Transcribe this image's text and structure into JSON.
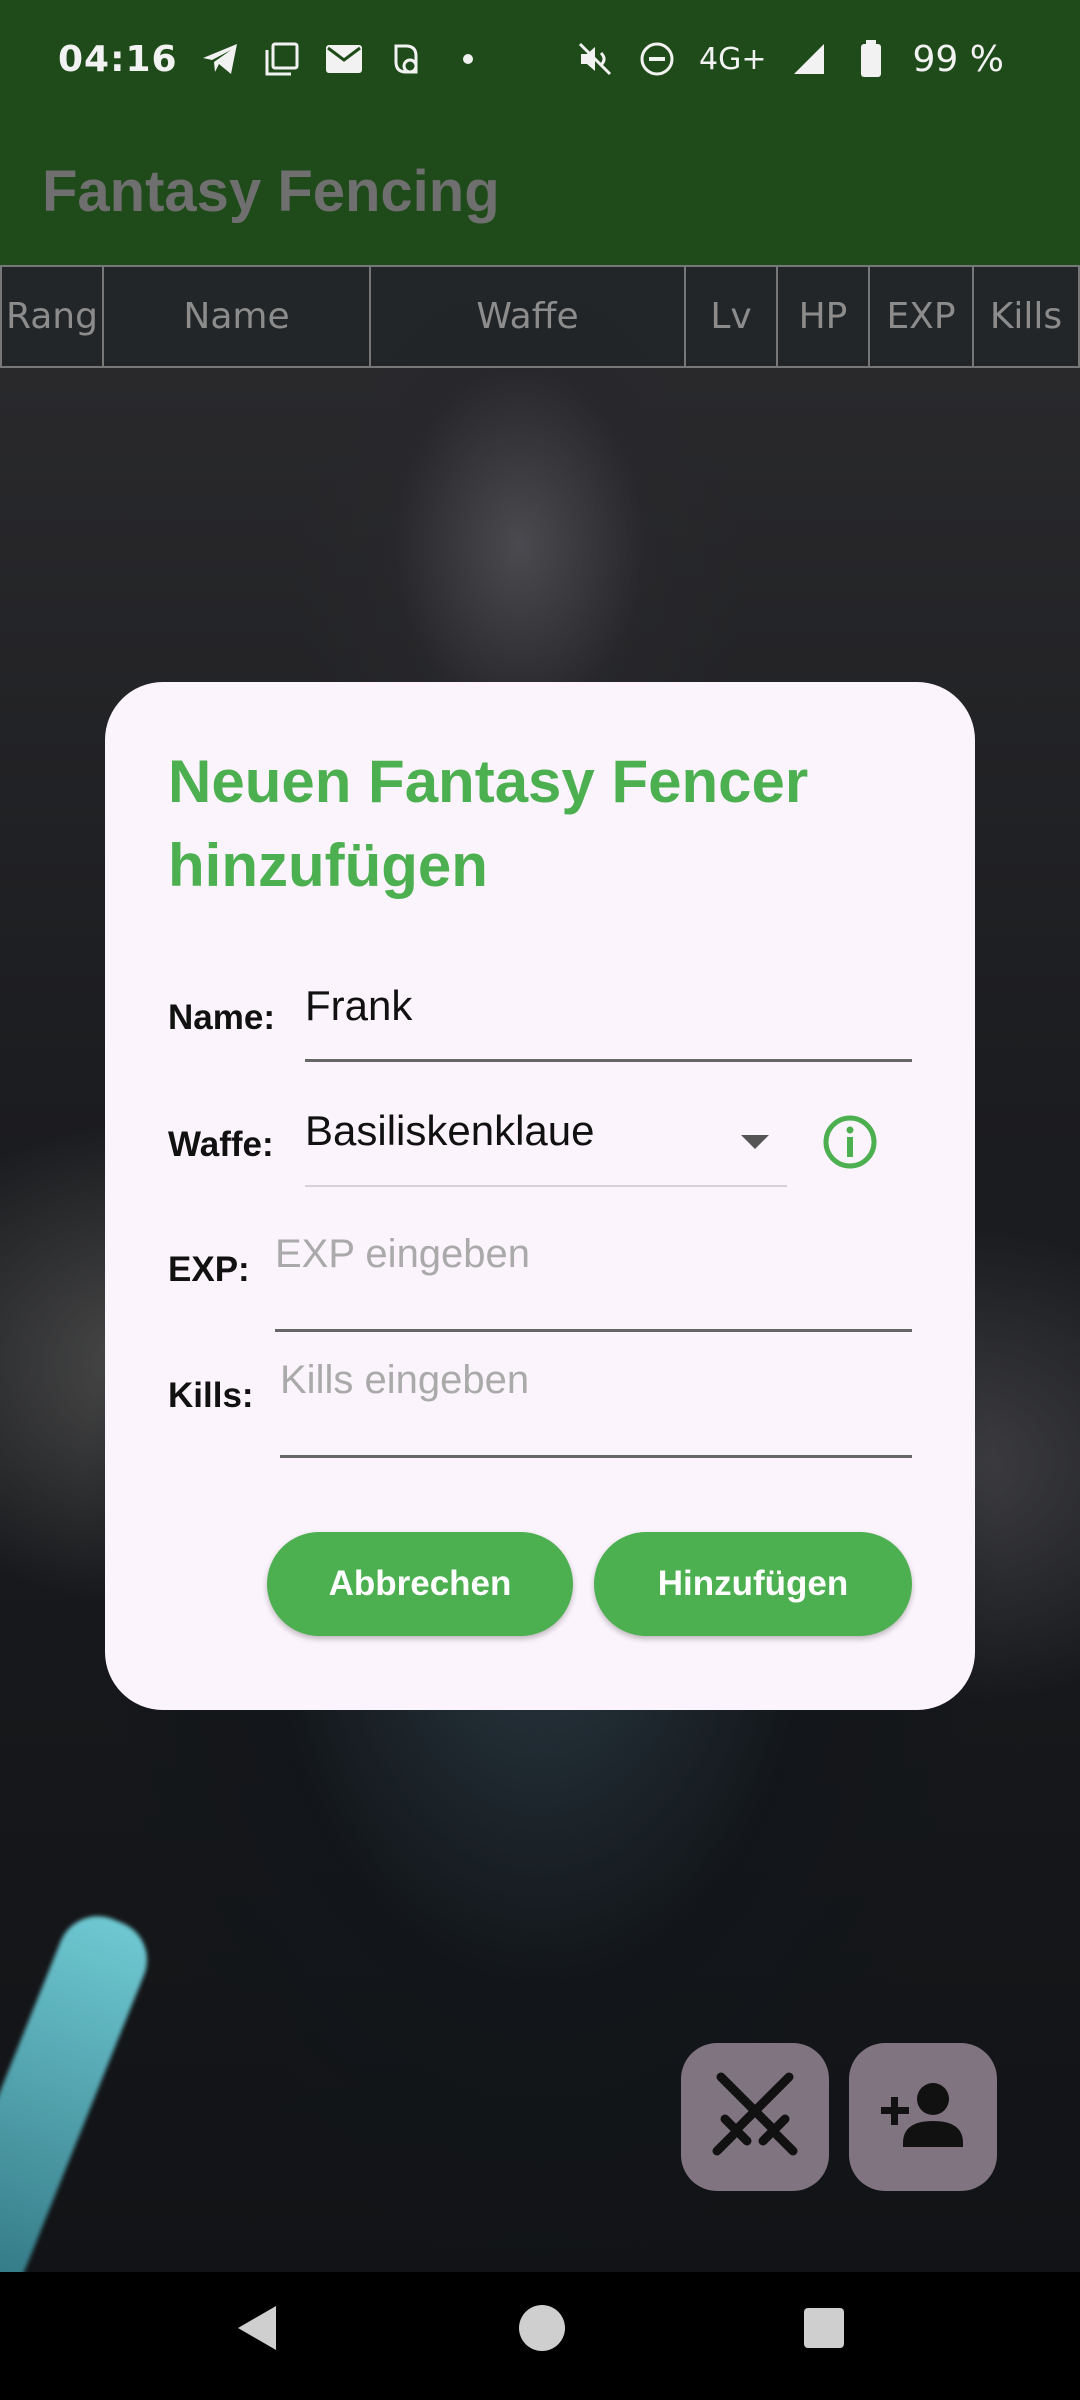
{
  "status_bar": {
    "time": "04:16",
    "left_icons": [
      "telegram-icon",
      "screen-copy-icon",
      "mail-icon",
      "app-notification-icon",
      "more-dot-icon"
    ],
    "network": "4G+",
    "battery": "99 %",
    "right_icons": [
      "mute-icon",
      "do-not-disturb-icon",
      "signal-icon",
      "battery-icon"
    ]
  },
  "app_bar": {
    "title": "Fantasy Fencing"
  },
  "table": {
    "columns": [
      "Rang",
      "Name",
      "Waffe",
      "Lv",
      "HP",
      "EXP",
      "Kills"
    ]
  },
  "dialog": {
    "title": "Neuen Fantasy Fencer hinzufügen",
    "name_label": "Name:",
    "name_value": "Frank",
    "weapon_label": "Waffe:",
    "weapon_value": "Basiliskenklaue",
    "exp_label": "EXP:",
    "exp_placeholder": "EXP eingeben",
    "kills_label": "Kills:",
    "kills_placeholder": "Kills eingeben",
    "cancel_label": "Abbrechen",
    "add_label": "Hinzufügen"
  },
  "fabs": {
    "battle_icon": "crossed-swords-icon",
    "add_person_icon": "add-person-icon"
  },
  "nav": {
    "icons": [
      "back-icon",
      "home-icon",
      "recents-icon"
    ]
  },
  "colors": {
    "app_bar": "#1f4a19",
    "accent": "#4caf50",
    "dialog_bg": "#fcf4fc",
    "fab_bg": "#807480"
  }
}
